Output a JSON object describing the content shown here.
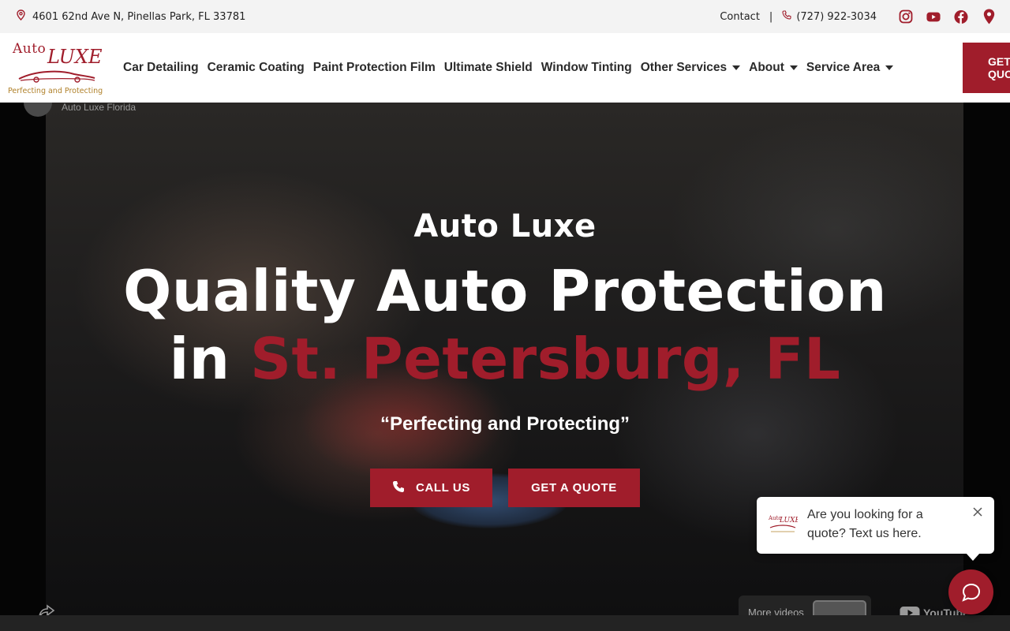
{
  "topbar": {
    "address": "4601 62nd Ave N, Pinellas Park, FL 33781",
    "contact_label": "Contact",
    "separator": "|",
    "phone": "(727) 922-3034",
    "social_icons": [
      "instagram-icon",
      "youtube-icon",
      "facebook-icon",
      "map-pin-icon"
    ]
  },
  "logo": {
    "word1": "Auto",
    "word2": "LUXE",
    "tagline": "Perfecting and Protecting"
  },
  "nav": {
    "items": [
      {
        "label": "Car Detailing",
        "dropdown": false
      },
      {
        "label": "Ceramic Coating",
        "dropdown": false
      },
      {
        "label": "Paint Protection Film",
        "dropdown": false
      },
      {
        "label": "Ultimate Shield",
        "dropdown": false
      },
      {
        "label": "Window Tinting",
        "dropdown": false
      },
      {
        "label": "Other Services",
        "dropdown": true
      },
      {
        "label": "About",
        "dropdown": true
      },
      {
        "label": "Service Area",
        "dropdown": true
      }
    ],
    "cta_line1": "GET",
    "cta_line2": "QUO"
  },
  "video": {
    "channel_name": "Auto Luxe Florida",
    "more_videos": "More videos",
    "youtube_label": "YouTube"
  },
  "hero": {
    "kicker": "Auto Luxe",
    "headline_line1": "Quality Auto Protection",
    "headline_in": "in",
    "headline_accent": "St. Petersburg, FL",
    "tagline": "“Perfecting and Protecting”",
    "call_button": "CALL US",
    "quote_button": "GET A QUOTE"
  },
  "chat": {
    "message": "Are you looking for a quote? Text us here."
  },
  "colors": {
    "brand_red": "#a01d2b",
    "gold": "#b0812a",
    "topbar_bg": "#f3f3f3"
  }
}
